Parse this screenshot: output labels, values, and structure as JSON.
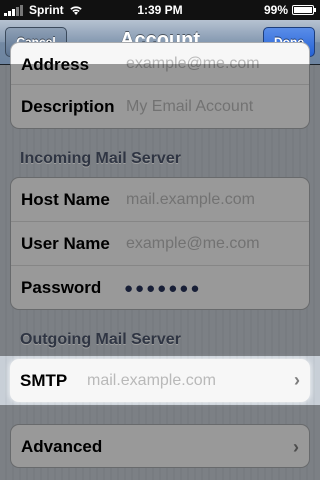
{
  "status": {
    "carrier": "Sprint",
    "time": "1:39 PM",
    "battery": "99%",
    "battery_level": 0.99
  },
  "nav": {
    "cancel_label": "Cancel",
    "title": "Account",
    "done_label": "Done"
  },
  "account_group": {
    "rows": [
      {
        "label": "Address",
        "value": "example@me.com"
      },
      {
        "label": "Description",
        "value": "My Email Account"
      }
    ]
  },
  "incoming": {
    "title": "Incoming Mail Server",
    "rows": [
      {
        "label": "Host Name",
        "value": "mail.example.com"
      },
      {
        "label": "User Name",
        "value": "example@me.com"
      },
      {
        "label": "Password",
        "value": "●●●●●●●"
      }
    ]
  },
  "outgoing": {
    "title": "Outgoing Mail Server",
    "smtp_label": "SMTP",
    "smtp_value": "mail.example.com"
  },
  "advanced_label": "Advanced",
  "icons": [
    "signal-icon",
    "wifi-icon",
    "battery-icon",
    "chevron-right-icon"
  ]
}
